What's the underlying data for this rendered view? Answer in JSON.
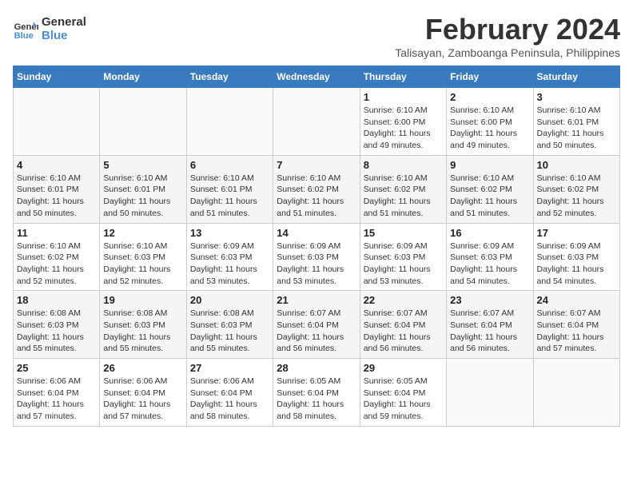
{
  "logo": {
    "line1": "General",
    "line2": "Blue"
  },
  "title": "February 2024",
  "location": "Talisayan, Zamboanga Peninsula, Philippines",
  "days_header": [
    "Sunday",
    "Monday",
    "Tuesday",
    "Wednesday",
    "Thursday",
    "Friday",
    "Saturday"
  ],
  "weeks": [
    [
      {
        "num": "",
        "info": ""
      },
      {
        "num": "",
        "info": ""
      },
      {
        "num": "",
        "info": ""
      },
      {
        "num": "",
        "info": ""
      },
      {
        "num": "1",
        "info": "Sunrise: 6:10 AM\nSunset: 6:00 PM\nDaylight: 11 hours\nand 49 minutes."
      },
      {
        "num": "2",
        "info": "Sunrise: 6:10 AM\nSunset: 6:00 PM\nDaylight: 11 hours\nand 49 minutes."
      },
      {
        "num": "3",
        "info": "Sunrise: 6:10 AM\nSunset: 6:01 PM\nDaylight: 11 hours\nand 50 minutes."
      }
    ],
    [
      {
        "num": "4",
        "info": "Sunrise: 6:10 AM\nSunset: 6:01 PM\nDaylight: 11 hours\nand 50 minutes."
      },
      {
        "num": "5",
        "info": "Sunrise: 6:10 AM\nSunset: 6:01 PM\nDaylight: 11 hours\nand 50 minutes."
      },
      {
        "num": "6",
        "info": "Sunrise: 6:10 AM\nSunset: 6:01 PM\nDaylight: 11 hours\nand 51 minutes."
      },
      {
        "num": "7",
        "info": "Sunrise: 6:10 AM\nSunset: 6:02 PM\nDaylight: 11 hours\nand 51 minutes."
      },
      {
        "num": "8",
        "info": "Sunrise: 6:10 AM\nSunset: 6:02 PM\nDaylight: 11 hours\nand 51 minutes."
      },
      {
        "num": "9",
        "info": "Sunrise: 6:10 AM\nSunset: 6:02 PM\nDaylight: 11 hours\nand 51 minutes."
      },
      {
        "num": "10",
        "info": "Sunrise: 6:10 AM\nSunset: 6:02 PM\nDaylight: 11 hours\nand 52 minutes."
      }
    ],
    [
      {
        "num": "11",
        "info": "Sunrise: 6:10 AM\nSunset: 6:02 PM\nDaylight: 11 hours\nand 52 minutes."
      },
      {
        "num": "12",
        "info": "Sunrise: 6:10 AM\nSunset: 6:03 PM\nDaylight: 11 hours\nand 52 minutes."
      },
      {
        "num": "13",
        "info": "Sunrise: 6:09 AM\nSunset: 6:03 PM\nDaylight: 11 hours\nand 53 minutes."
      },
      {
        "num": "14",
        "info": "Sunrise: 6:09 AM\nSunset: 6:03 PM\nDaylight: 11 hours\nand 53 minutes."
      },
      {
        "num": "15",
        "info": "Sunrise: 6:09 AM\nSunset: 6:03 PM\nDaylight: 11 hours\nand 53 minutes."
      },
      {
        "num": "16",
        "info": "Sunrise: 6:09 AM\nSunset: 6:03 PM\nDaylight: 11 hours\nand 54 minutes."
      },
      {
        "num": "17",
        "info": "Sunrise: 6:09 AM\nSunset: 6:03 PM\nDaylight: 11 hours\nand 54 minutes."
      }
    ],
    [
      {
        "num": "18",
        "info": "Sunrise: 6:08 AM\nSunset: 6:03 PM\nDaylight: 11 hours\nand 55 minutes."
      },
      {
        "num": "19",
        "info": "Sunrise: 6:08 AM\nSunset: 6:03 PM\nDaylight: 11 hours\nand 55 minutes."
      },
      {
        "num": "20",
        "info": "Sunrise: 6:08 AM\nSunset: 6:03 PM\nDaylight: 11 hours\nand 55 minutes."
      },
      {
        "num": "21",
        "info": "Sunrise: 6:07 AM\nSunset: 6:04 PM\nDaylight: 11 hours\nand 56 minutes."
      },
      {
        "num": "22",
        "info": "Sunrise: 6:07 AM\nSunset: 6:04 PM\nDaylight: 11 hours\nand 56 minutes."
      },
      {
        "num": "23",
        "info": "Sunrise: 6:07 AM\nSunset: 6:04 PM\nDaylight: 11 hours\nand 56 minutes."
      },
      {
        "num": "24",
        "info": "Sunrise: 6:07 AM\nSunset: 6:04 PM\nDaylight: 11 hours\nand 57 minutes."
      }
    ],
    [
      {
        "num": "25",
        "info": "Sunrise: 6:06 AM\nSunset: 6:04 PM\nDaylight: 11 hours\nand 57 minutes."
      },
      {
        "num": "26",
        "info": "Sunrise: 6:06 AM\nSunset: 6:04 PM\nDaylight: 11 hours\nand 57 minutes."
      },
      {
        "num": "27",
        "info": "Sunrise: 6:06 AM\nSunset: 6:04 PM\nDaylight: 11 hours\nand 58 minutes."
      },
      {
        "num": "28",
        "info": "Sunrise: 6:05 AM\nSunset: 6:04 PM\nDaylight: 11 hours\nand 58 minutes."
      },
      {
        "num": "29",
        "info": "Sunrise: 6:05 AM\nSunset: 6:04 PM\nDaylight: 11 hours\nand 59 minutes."
      },
      {
        "num": "",
        "info": ""
      },
      {
        "num": "",
        "info": ""
      }
    ]
  ]
}
